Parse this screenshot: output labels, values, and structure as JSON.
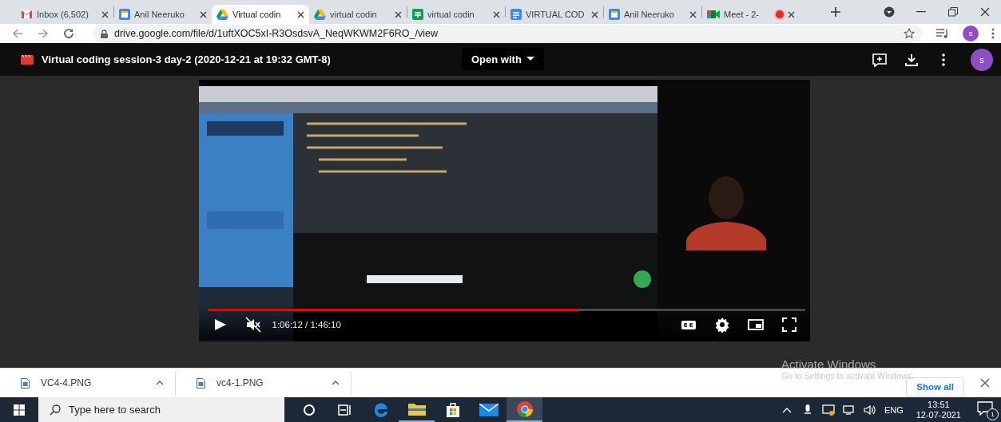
{
  "tabs": [
    {
      "title": "Inbox (6,502)",
      "kind": "mail",
      "selected": false,
      "recording": false
    },
    {
      "title": "Anil Neeruko",
      "kind": "calendar",
      "selected": false,
      "recording": false
    },
    {
      "title": "Virtual codin",
      "kind": "drive",
      "selected": true,
      "recording": false
    },
    {
      "title": "virtual codin",
      "kind": "drive",
      "selected": false,
      "recording": false
    },
    {
      "title": "virtual codin",
      "kind": "sheets",
      "selected": false,
      "recording": false
    },
    {
      "title": "VIRTUAL COD",
      "kind": "docs",
      "selected": false,
      "recording": false
    },
    {
      "title": "Anil Neeruko",
      "kind": "calendar",
      "selected": false,
      "recording": false
    },
    {
      "title": "Meet - 2-",
      "kind": "meet",
      "selected": false,
      "recording": true
    }
  ],
  "address": {
    "url": "drive.google.com/file/d/1uftXOC5xI-R3OsdsvA_NeqWKWM2F6RO_/view",
    "profile": "s"
  },
  "viewer": {
    "title": "Virtual coding session-3 day-2 (2020-12-21 at 19:32 GMT-8)",
    "open_with": "Open with",
    "profile": "s"
  },
  "player": {
    "progress": {
      "level": 0.62
    },
    "playing": false,
    "muted": true,
    "time": "1:06:12 / 1:46:10"
  },
  "downloads": {
    "items": [
      {
        "name": "VC4-4.PNG"
      },
      {
        "name": "vc4-1.PNG"
      }
    ],
    "show_all": "Show all"
  },
  "activation_notice": {
    "title": "Activate Windows",
    "text": "Go to Settings to activate Windows."
  },
  "taskbar": {
    "search_placeholder": "Type here to search",
    "apps": [
      {
        "kind": "cortana",
        "open": false,
        "active": false
      },
      {
        "kind": "task-view",
        "open": false,
        "active": false
      },
      {
        "kind": "edge",
        "open": false,
        "active": false
      },
      {
        "kind": "explorer",
        "open": true,
        "active": false
      },
      {
        "kind": "store",
        "open": false,
        "active": false
      },
      {
        "kind": "mail",
        "open": false,
        "active": false
      },
      {
        "kind": "chrome",
        "open": true,
        "active": true
      }
    ],
    "language": "ENG",
    "time": "13:51",
    "date": "12-07-2021",
    "notifications": "1"
  }
}
